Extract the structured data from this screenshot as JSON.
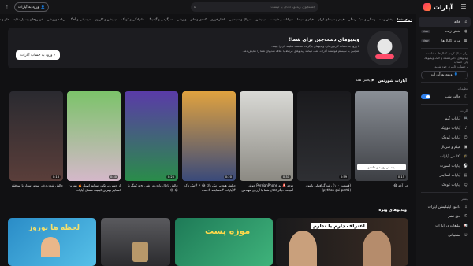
{
  "app": {
    "name": "آپارات"
  },
  "topbar": {
    "search_placeholder": "جستجوی ویدیو، کانال یا لیست",
    "login_label": "ورود به آپارات"
  },
  "categories": [
    {
      "label": "برای شما",
      "active": true
    },
    {
      "label": "پخش زنده"
    },
    {
      "label": "زندگی و سبک زندگی"
    },
    {
      "label": "فیلم و سینمای ایران"
    },
    {
      "label": "فیلم و سینما"
    },
    {
      "label": "حیوانات و طبیعت"
    },
    {
      "label": "انیمیشن"
    },
    {
      "label": "سریال و سینمایی"
    },
    {
      "label": "اخبار فوری"
    },
    {
      "label": "کمدی و طنز"
    },
    {
      "label": "ورزشی"
    },
    {
      "label": "سرگرمی و گیمینگ"
    },
    {
      "label": "خانوادگی و کودک"
    },
    {
      "label": "انیمیشن و کارتون"
    },
    {
      "label": "موسیقی و آهنگ"
    },
    {
      "label": "برنامه ورزشی"
    },
    {
      "label": "خودروها و وسایل نقلیه"
    },
    {
      "label": "علم و تکنولوژی"
    }
  ],
  "sidebar": {
    "items": [
      {
        "label": "خانه",
        "icon": "home-icon"
      },
      {
        "label": "پخش زنده",
        "icon": "live-icon",
        "badge": "New"
      },
      {
        "label": "مرور کانال‌ها",
        "icon": "channels-icon",
        "badge": "New"
      }
    ],
    "info": [
      "برای دنبال کردن کانال‌ها، مشاهده",
      "ویدیوهای ذخیره‌شده و لایک ویدیوها، وارد حساب",
      "یا حساب کاربری خود شوید."
    ],
    "login_label": "ورود به آپارات",
    "settings_header": "تنظیمات",
    "dark_mode_label": "حالت شب",
    "aparat_header": "آپارات",
    "links": [
      "آپارات گیم",
      "آپارات موزیک",
      "آپارات کودک",
      "فیلم و سریال",
      "آکادمی آپارات",
      "آپارات اسپرت",
      "آپارات اسلایدر",
      "آپارات کودک"
    ],
    "more_header": "بیشتر",
    "bottom_links": [
      "دانلود اپلیکیشن آپارات",
      "حق نشر",
      "تبلیغات در آپارات",
      "پشتیبانی"
    ]
  },
  "banner": {
    "title": "ویدیوهای دست‌چین برای شما!",
    "subtitle1": "با ورود به حساب کاربری تان، ویدیوهای برگزیده مناسب سلیقه تان را ببینید.",
    "subtitle2": "همچنین به سیستم هوشمند آپارات کمک میکنید ویدیوهای مرتبط با علاقه مندیهای شما را نمایش دهد.",
    "button_label": "ورود به حساب آپارات"
  },
  "shorts_section": {
    "title": "آپارات شورتس",
    "play_all_label": "پخش همه",
    "items": [
      {
        "title": "چرا آخه 😂",
        "duration": "0:15",
        "caption": "بچه هر روز منو ماماتو"
      },
      {
        "title": "(قسمت ۱۰۰) رشد گرافیکی پایتون (python gui part1)",
        "duration": "0:59"
      },
      {
        "title": "توجه 🚨 به PersianPhone جوش آمیخت دیگر کانال شما با آرزدی مهندس",
        "duration": "0:31"
      },
      {
        "title": "چالش هیجانی تیک تاک 😂 ⚡ #تیک تاک #آپارات #مسابقه #خنده",
        "duration": "0:20"
      },
      {
        "title": "چالش باحال بازی ورزشی بچ و کینگ با 😂 😅",
        "duration": "0:25"
      },
      {
        "title": "از جنس پرفکت استایم اصیل 🔥 بهترین استایم بهترین کیفیت مسئل آپارات",
        "duration": "0:30"
      },
      {
        "title": "چالش شدن دختر موتور سوار با موافقه",
        "duration": "0:18"
      }
    ]
  },
  "recommended_section": {
    "title": "ویدئوهای ویژه",
    "items": [
      {
        "overlay": "اعتراف دارم یا ندارم"
      },
      {
        "overlay": "موزه پست"
      },
      {
        "overlay": ""
      },
      {
        "overlay": "لحظه ها نوروز"
      }
    ]
  },
  "colors": {
    "accent": "#ff3b5c",
    "toggle": "#2f80ed",
    "background": "#111113"
  }
}
